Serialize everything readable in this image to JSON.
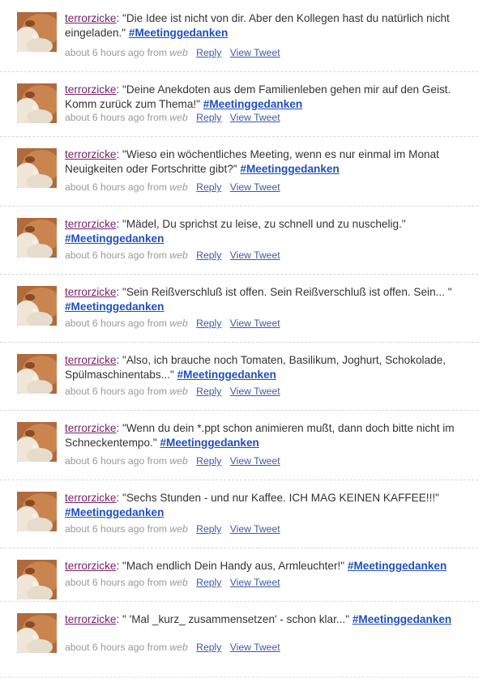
{
  "timeline": {
    "statuses": [
      {
        "user": "terrorzicke",
        "text": "\"Die Idee ist nicht von dir. Aber den Kollegen hast du natürlich nicht eingeladen.\"",
        "hashtag": "#Meetinggedanken",
        "time": "about 6 hours ago",
        "from": "from",
        "source": "web",
        "reply": "Reply",
        "view": "View Tweet"
      },
      {
        "user": "terrorzicke",
        "text": "\"Deine Anekdoten aus dem Familienleben gehen mir auf den Geist. Komm zurück zum Thema!\"",
        "hashtag": "#Meetinggedanken",
        "time": "about 6 hours ago",
        "from": "from",
        "source": "web",
        "reply": "Reply",
        "view": "View Tweet"
      },
      {
        "user": "terrorzicke",
        "text": "\"Wieso ein wöchentliches Meeting, wenn es nur einmal im Monat Neuigkeiten oder Fortschritte gibt?\"",
        "hashtag": "#Meetinggedanken",
        "time": "about 6 hours ago",
        "from": "from",
        "source": "web",
        "reply": "Reply",
        "view": "View Tweet"
      },
      {
        "user": "terrorzicke",
        "text": "\"Mädel, Du sprichst zu leise, zu schnell und zu nuschelig.\"",
        "hashtag": "#Meetinggedanken",
        "time": "about 6 hours ago",
        "from": "from",
        "source": "web",
        "reply": "Reply",
        "view": "View Tweet"
      },
      {
        "user": "terrorzicke",
        "text": "\"Sein Reißverschluß ist offen. Sein Reißverschluß ist offen. Sein... \"",
        "hashtag": "#Meetinggedanken",
        "time": "about 6 hours ago",
        "from": "from",
        "source": "web",
        "reply": "Reply",
        "view": "View Tweet"
      },
      {
        "user": "terrorzicke",
        "text": "\"Also, ich brauche noch Tomaten, Basilikum, Joghurt, Schokolade, Spülmaschinentabs...\"",
        "hashtag": "#Meetinggedanken",
        "time": "about 6 hours ago",
        "from": "from",
        "source": "web",
        "reply": "Reply",
        "view": "View Tweet"
      },
      {
        "user": "terrorzicke",
        "text": "\"Wenn du dein *.ppt schon animieren mußt, dann doch bitte nicht im Schneckentempo.\"",
        "hashtag": "#Meetinggedanken",
        "time": "about 6 hours ago",
        "from": "from",
        "source": "web",
        "reply": "Reply",
        "view": "View Tweet"
      },
      {
        "user": "terrorzicke",
        "text": "\"Sechs Stunden - und nur Kaffee. ICH MAG KEINEN KAFFEE!!!\"",
        "hashtag": "#Meetinggedanken",
        "time": "about 6 hours ago",
        "from": "from",
        "source": "web",
        "reply": "Reply",
        "view": "View Tweet"
      },
      {
        "user": "terrorzicke",
        "text": "\"Mach endlich Dein Handy aus, Armleuchter!\"",
        "hashtag": "#Meetinggedanken",
        "time": "about 6 hours ago",
        "from": "from",
        "source": "web",
        "reply": "Reply",
        "view": "View Tweet"
      },
      {
        "user": "terrorzicke",
        "text": "\" 'Mal _kurz_ zusammensetzen' - schon klar...\"",
        "hashtag": "#Meetinggedanken",
        "time": "about 6 hours ago",
        "from": "from",
        "source": "web",
        "reply": "Reply",
        "view": "View Tweet"
      }
    ]
  },
  "colors": {
    "screen_name": "#7a1f68",
    "hashtag": "#1f4fbf",
    "link": "#3b5aa6",
    "meta": "#999999",
    "divider": "#d2dada"
  },
  "icons": {
    "avatar": "cartoon-face-avatar-icon"
  }
}
